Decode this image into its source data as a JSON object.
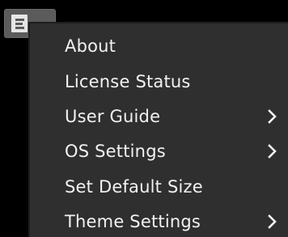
{
  "menu_button": {
    "icon": "hamburger-menu-icon"
  },
  "dropdown": {
    "items": [
      {
        "label": "About",
        "has_submenu": false
      },
      {
        "label": "License Status",
        "has_submenu": false
      },
      {
        "label": "User Guide",
        "has_submenu": true,
        "icon": "chevron-right-icon"
      },
      {
        "label": "OS Settings",
        "has_submenu": true,
        "icon": "chevron-right-icon"
      },
      {
        "label": "Set Default Size",
        "has_submenu": false
      },
      {
        "label": "Theme Settings",
        "has_submenu": true,
        "icon": "chevron-right-icon"
      }
    ]
  },
  "colors": {
    "background": "#000000",
    "menu_background": "#2f2f2f",
    "menu_text": "#f2f2f2",
    "button_background": "#5b5b5b"
  }
}
